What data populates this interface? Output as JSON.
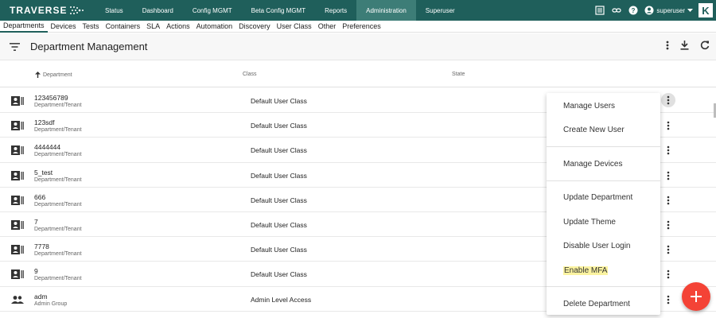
{
  "app": {
    "logo_text": "TRAVERSE",
    "nav": [
      {
        "label": "Status"
      },
      {
        "label": "Dashboard"
      },
      {
        "label": "Config MGMT"
      },
      {
        "label": "Beta Config MGMT"
      },
      {
        "label": "Reports"
      },
      {
        "label": "Administration",
        "active": true
      },
      {
        "label": "Superuser"
      }
    ],
    "user": "superuser",
    "brand_badge": "K"
  },
  "subnav": [
    "Departments",
    "Devices",
    "Tests",
    "Containers",
    "SLA",
    "Actions",
    "Automation",
    "Discovery",
    "User Class",
    "Other",
    "Preferences"
  ],
  "page": {
    "title": "Department Management"
  },
  "table": {
    "columns": {
      "department": "Department",
      "class": "Class",
      "state": "State"
    },
    "rows": [
      {
        "name": "123456789",
        "type": "Department/Tenant",
        "class": "Default User Class",
        "icon": "contact-card-icon"
      },
      {
        "name": "123sdf",
        "type": "Department/Tenant",
        "class": "Default User Class",
        "icon": "contact-card-icon"
      },
      {
        "name": "4444444",
        "type": "Department/Tenant",
        "class": "Default User Class",
        "icon": "contact-card-icon"
      },
      {
        "name": "5_test",
        "type": "Department/Tenant",
        "class": "Default User Class",
        "icon": "contact-card-icon"
      },
      {
        "name": "666",
        "type": "Department/Tenant",
        "class": "Default User Class",
        "icon": "contact-card-icon"
      },
      {
        "name": "7",
        "type": "Department/Tenant",
        "class": "Default User Class",
        "icon": "contact-card-icon"
      },
      {
        "name": "7778",
        "type": "Department/Tenant",
        "class": "Default User Class",
        "icon": "contact-card-icon"
      },
      {
        "name": "9",
        "type": "Department/Tenant",
        "class": "Default User Class",
        "icon": "contact-card-icon"
      },
      {
        "name": "adm",
        "type": "Admin Group",
        "class": "Admin Level Access",
        "icon": "group-icon"
      }
    ]
  },
  "context_menu": {
    "items": [
      "Manage Users",
      "Create New User",
      "Manage Devices",
      "Update Department",
      "Update Theme",
      "Disable User Login",
      "Enable MFA",
      "Delete Department"
    ],
    "highlighted": "Enable MFA"
  },
  "colors": {
    "topbar": "#1f5f5b",
    "active_nav": "#3d7d77",
    "fab": "#f44336",
    "highlight": "#fbf3a0"
  }
}
